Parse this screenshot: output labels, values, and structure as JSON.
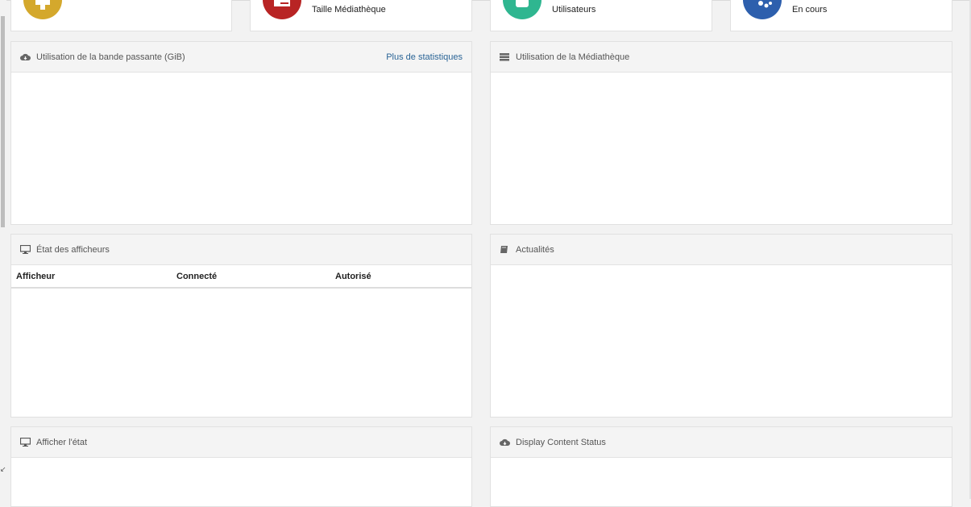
{
  "stat_cards": [
    {
      "label": "",
      "color": "#d4a82c"
    },
    {
      "label": "Taille Médiathèque",
      "color": "#b82424"
    },
    {
      "label": "Utilisateurs",
      "color": "#2fb690"
    },
    {
      "label": "En cours",
      "color": "#2d5fad"
    }
  ],
  "bandwidth": {
    "title": "Utilisation de la bande passante (GiB)",
    "link": "Plus de statistiques",
    "icon": "cloud-icon"
  },
  "library": {
    "title": "Utilisation de la Médiathèque",
    "icon": "database-icon"
  },
  "displays": {
    "title": "État des afficheurs",
    "icon": "monitor-icon",
    "columns": [
      "Afficheur",
      "Connecté",
      "Autorisé"
    ]
  },
  "news": {
    "title": "Actualités",
    "icon": "book-icon"
  },
  "display_status": {
    "title": "Afficher l'état",
    "icon": "monitor-icon"
  },
  "content_status": {
    "title": "Display Content Status",
    "icon": "cloud-download-icon"
  }
}
